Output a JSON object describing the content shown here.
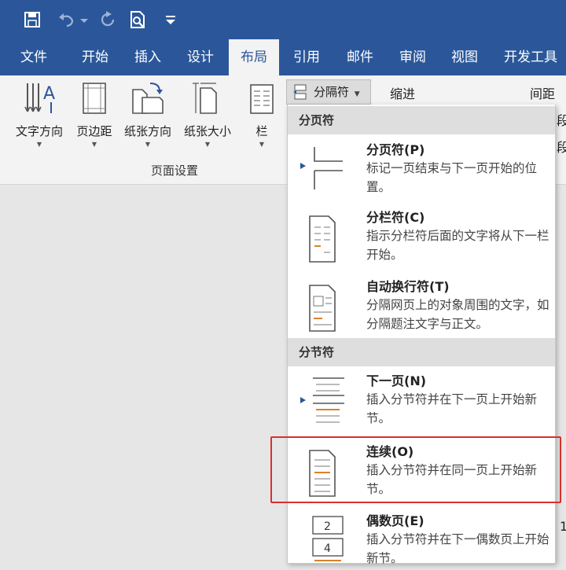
{
  "tabs": [
    "文件",
    "开始",
    "插入",
    "设计",
    "布局",
    "引用",
    "邮件",
    "审阅",
    "视图",
    "开发工具"
  ],
  "active_tab": "布局",
  "ribbon": {
    "buttons": [
      "文字方向",
      "页边距",
      "纸张方向",
      "纸张大小",
      "栏"
    ],
    "group_label": "页面设置",
    "breaks_label": "分隔符",
    "indent_label": "缩进",
    "spacing_label": "间距",
    "para_side": "段",
    "right_edge_digit": "1"
  },
  "menu": {
    "section_page": "分页符",
    "section_section": "分节符",
    "items": [
      {
        "title": "分页符(P)",
        "desc": "标记一页结束与下一页开始的位置。"
      },
      {
        "title": "分栏符(C)",
        "desc": "指示分栏符后面的文字将从下一栏开始。"
      },
      {
        "title": "自动换行符(T)",
        "desc": "分隔网页上的对象周围的文字，如分隔题注文字与正文。"
      },
      {
        "title": "下一页(N)",
        "desc": "插入分节符并在下一页上开始新节。"
      },
      {
        "title": "连续(O)",
        "desc": "插入分节符并在同一页上开始新节。"
      },
      {
        "title": "偶数页(E)",
        "desc": "插入分节符并在下一偶数页上开始新节。"
      }
    ],
    "even_icon_nums": [
      "2",
      "4"
    ]
  },
  "colors": {
    "accent": "#2b579a",
    "highlight": "#d9302c"
  }
}
